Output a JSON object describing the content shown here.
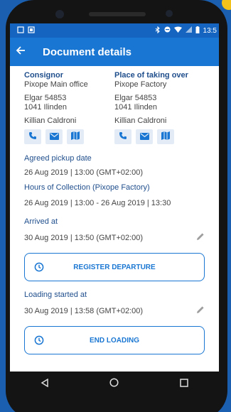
{
  "status_bar": {
    "time": "13:5"
  },
  "app_bar": {
    "title": "Document details"
  },
  "consignor": {
    "heading": "Consignor",
    "name": "Pixope Main office",
    "address_line1": "Elgar 54853",
    "address_line2": "1041 Ilinden",
    "contact": "Killian Caldroni"
  },
  "place_of_taking_over": {
    "heading": "Place of taking over",
    "name": "Pixope Factory",
    "address_line1": "Elgar 54853",
    "address_line2": "1041 Ilinden",
    "contact": "Killian Caldroni"
  },
  "pickup": {
    "agreed_label": "Agreed pickup date",
    "agreed_value": "26 Aug 2019 | 13:00 (GMT+02:00)",
    "hours_label": "Hours of Collection (Pixope Factory)",
    "hours_value": "26 Aug 2019 | 13:00 - 26 Aug 2019 | 13:30"
  },
  "arrived": {
    "label": "Arrived at",
    "value": "30 Aug 2019 | 13:50 (GMT+02:00)",
    "button_label": "REGISTER DEPARTURE"
  },
  "loading": {
    "label": "Loading started at",
    "value": "30 Aug 2019 | 13:58 (GMT+02:00)",
    "button_label": "END LOADING"
  },
  "icons": {
    "phone": "phone-icon",
    "email": "mail-icon",
    "map": "map-icon",
    "edit": "pencil-icon",
    "clock": "clock-icon"
  },
  "colors": {
    "primary": "#1976d2",
    "status_bar": "#1565c0",
    "label": "#1f4e8c",
    "icon_bg": "#e3ecf6"
  }
}
